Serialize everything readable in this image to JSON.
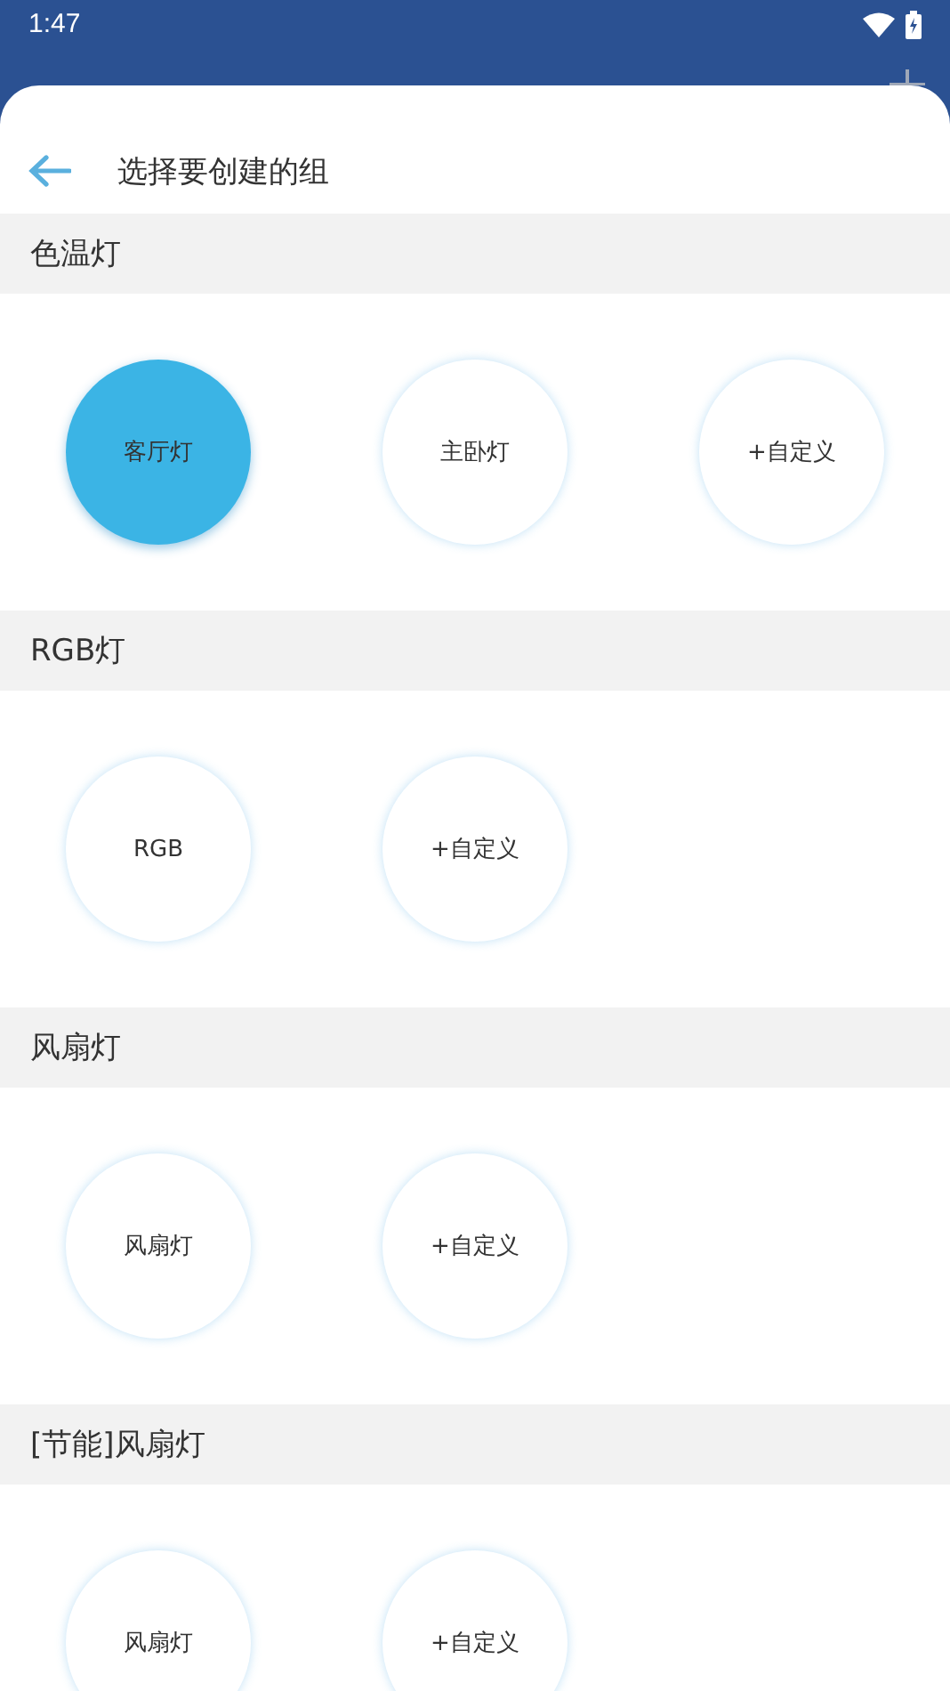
{
  "status_bar": {
    "time": "1:47"
  },
  "sheet": {
    "title": "选择要创建的组",
    "groups": [
      {
        "name": "色温灯",
        "items": [
          {
            "label": "客厅灯",
            "selected": true
          },
          {
            "label": "主卧灯",
            "selected": false
          },
          {
            "label": "+自定义",
            "selected": false
          }
        ]
      },
      {
        "name": "RGB灯",
        "items": [
          {
            "label": "RGB",
            "selected": false
          },
          {
            "label": "+自定义",
            "selected": false
          }
        ]
      },
      {
        "name": "风扇灯",
        "items": [
          {
            "label": "风扇灯",
            "selected": false
          },
          {
            "label": "+自定义",
            "selected": false
          }
        ]
      },
      {
        "name": "[节能]风扇灯",
        "items": [
          {
            "label": "风扇灯",
            "selected": false
          },
          {
            "label": "+自定义",
            "selected": false
          }
        ]
      }
    ]
  }
}
